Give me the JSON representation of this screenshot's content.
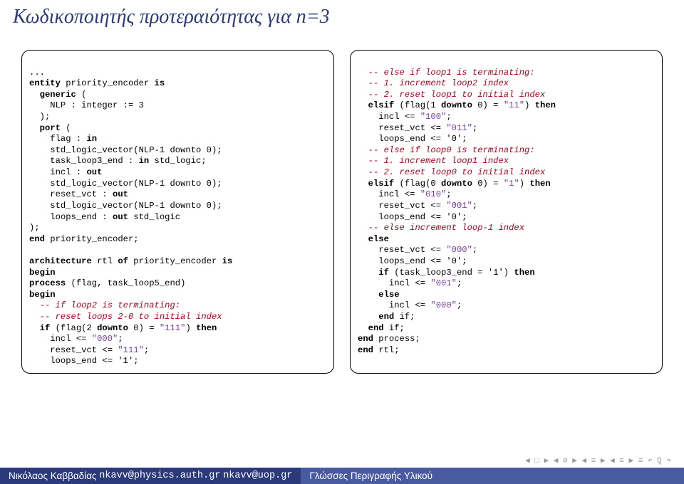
{
  "title": "Κωδικοποιητής προτεραιότητας για n=3",
  "code_left": {
    "l1a": "...",
    "l2a": "entity",
    "l2b": " priority_encoder ",
    "l2c": "is",
    "l3a": "  generic",
    "l3b": " (",
    "l4": "    NLP : integer := 3",
    "l5": "  );",
    "l6a": "  port",
    "l6b": " (",
    "l7a": "    flag : ",
    "l7b": "in",
    "l8": "    std_logic_vector(NLP-1 downto 0);",
    "l9a": "    task_loop3_end : ",
    "l9b": "in",
    "l9c": " std_logic;",
    "l10a": "    incl : ",
    "l10b": "out",
    "l11": "    std_logic_vector(NLP-1 downto 0);",
    "l12a": "    reset_vct : ",
    "l12b": "out",
    "l13": "    std_logic_vector(NLP-1 downto 0);",
    "l14a": "    loops_end : ",
    "l14b": "out",
    "l14c": " std_logic",
    "l15": ");",
    "l16a": "end",
    "l16b": " priority_encoder;",
    "blank1": "",
    "l17a": "architecture",
    "l17b": " rtl ",
    "l17c": "of",
    "l17d": " priority_encoder ",
    "l17e": "is",
    "l18": "begin",
    "l19a": "process",
    "l19b": " (flag, task_loop5_end)",
    "l20": "begin",
    "l21": "  -- if loop2 is terminating:",
    "l22": "  -- reset loops 2-0 to initial index",
    "l23a": "  if",
    "l23b": " (flag(2 ",
    "l23c": "downto",
    "l23d": " 0) = ",
    "l23e": "\"111\"",
    "l23f": ") ",
    "l23g": "then",
    "l24a": "    incl <= ",
    "l24b": "\"000\"",
    "l24c": ";",
    "l25a": "    reset_vct <= ",
    "l25b": "\"111\"",
    "l25c": ";",
    "l26": "    loops_end <= '1';"
  },
  "code_right": {
    "r1": "  -- else if loop1 is terminating:",
    "r2": "  -- 1. increment loop2 index",
    "r3": "  -- 2. reset loop1 to initial index",
    "r4a": "  elsif",
    "r4b": " (flag(1 ",
    "r4c": "downto",
    "r4d": " 0) = ",
    "r4e": "\"11\"",
    "r4f": ") ",
    "r4g": "then",
    "r5a": "    incl <= ",
    "r5b": "\"100\"",
    "r5c": ";",
    "r6a": "    reset_vct <= ",
    "r6b": "\"011\"",
    "r6c": ";",
    "r7": "    loops_end <= '0';",
    "r8": "  -- else if loop0 is terminating:",
    "r9": "  -- 1. increment loop1 index",
    "r10": "  -- 2. reset loop0 to initial index",
    "r11a": "  elsif",
    "r11b": " (flag(0 ",
    "r11c": "downto",
    "r11d": " 0) = ",
    "r11e": "\"1\"",
    "r11f": ") ",
    "r11g": "then",
    "r12a": "    incl <= ",
    "r12b": "\"010\"",
    "r12c": ";",
    "r13a": "    reset_vct <= ",
    "r13b": "\"001\"",
    "r13c": ";",
    "r14": "    loops_end <= '0';",
    "r15": "  -- else increment loop-1 index",
    "r16": "  else",
    "r17a": "    reset_vct <= ",
    "r17b": "\"000\"",
    "r17c": ";",
    "r18": "    loops_end <= '0';",
    "r19a": "    if",
    "r19b": " (task_loop3_end = '1') ",
    "r19c": "then",
    "r20a": "      incl <= ",
    "r20b": "\"001\"",
    "r20c": ";",
    "r21": "    else",
    "r22a": "      incl <= ",
    "r22b": "\"000\"",
    "r22c": ";",
    "r23a": "    end",
    "r23b": " if;",
    "r24a": "  end",
    "r24b": " if;",
    "r25a": "end",
    "r25b": " process;",
    "r26a": "end",
    "r26b": " rtl;"
  },
  "footer": {
    "author": "Νικόλαος Καββαδίας",
    "email1": "nkavv@physics.auth.gr",
    "email2": "nkavv@uop.gr",
    "right": "Γλώσσες Περιγραφής Υλικού"
  },
  "navicons": "◀ □ ▶  ◀ ⊘ ▶  ◀ ≡ ▶  ◀ ≡ ▶   ≡   ↶ Q ↷"
}
